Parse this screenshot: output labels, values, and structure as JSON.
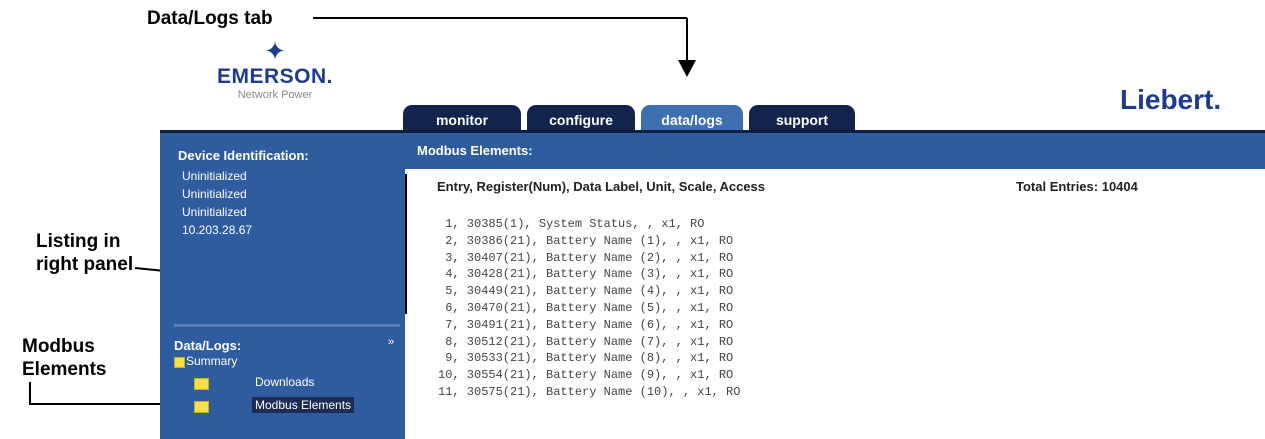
{
  "callouts": {
    "data_logs_tab": "Data/Logs tab",
    "listing_line1": "Listing in",
    "listing_line2": "right panel",
    "modbus_line1": "Modbus",
    "modbus_line2": "Elements"
  },
  "header": {
    "brand_name": "EMERSON.",
    "brand_sub": "Network Power",
    "right_logo": "Liebert."
  },
  "tabs": [
    {
      "label": "monitor",
      "active": false
    },
    {
      "label": "configure",
      "active": false
    },
    {
      "label": "data/logs",
      "active": true
    },
    {
      "label": "support",
      "active": false
    }
  ],
  "sidebar": {
    "device_heading": "Device Identification:",
    "device_lines": [
      "Uninitialized",
      "Uninitialized",
      "Uninitialized",
      "10.203.28.67"
    ],
    "expand_glyph": "»",
    "data_logs_heading": "Data/Logs:",
    "tree": {
      "root": "Summary",
      "children": [
        "Downloads",
        "Modbus Elements"
      ],
      "selected": "Modbus Elements"
    }
  },
  "panel": {
    "title": "Modbus Elements:",
    "columns": "Entry, Register(Num), Data Label, Unit, Scale, Access",
    "total": "Total Entries: 10404",
    "entries": [
      " 1, 30385(1), System Status, , x1, RO",
      " 2, 30386(21), Battery Name (1), , x1, RO",
      " 3, 30407(21), Battery Name (2), , x1, RO",
      " 4, 30428(21), Battery Name (3), , x1, RO",
      " 5, 30449(21), Battery Name (4), , x1, RO",
      " 6, 30470(21), Battery Name (5), , x1, RO",
      " 7, 30491(21), Battery Name (6), , x1, RO",
      " 8, 30512(21), Battery Name (7), , x1, RO",
      " 9, 30533(21), Battery Name (8), , x1, RO",
      "10, 30554(21), Battery Name (9), , x1, RO",
      "11, 30575(21), Battery Name (10), , x1, RO"
    ]
  }
}
